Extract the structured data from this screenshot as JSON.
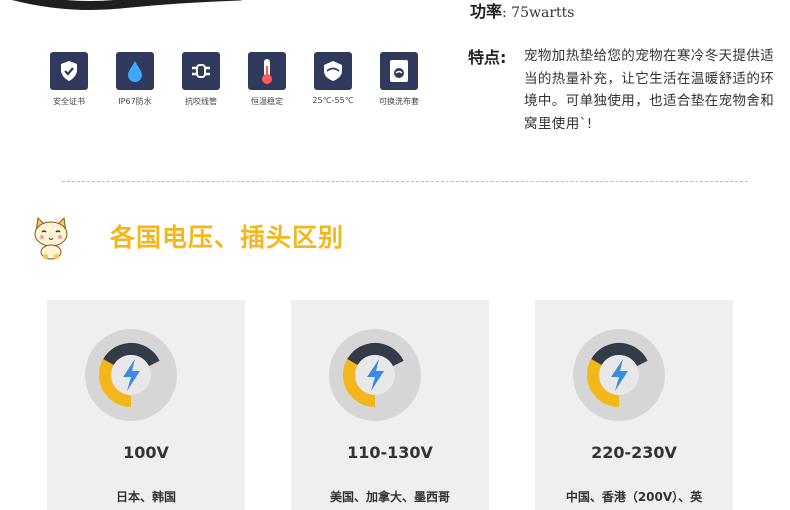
{
  "colors": {
    "accent": "#f3b71b",
    "icon_bg": "#2f3a5c",
    "card_bg": "#efefef"
  },
  "features": [
    {
      "icon": "shield-check-icon",
      "label": "安全证书"
    },
    {
      "icon": "water-drop-icon",
      "label": "IP67防水"
    },
    {
      "icon": "cable-link-icon",
      "label": "抗咬线管"
    },
    {
      "icon": "thermometer-icon",
      "label": "恒温稳定"
    },
    {
      "icon": "temperature-range-icon",
      "label": "25℃-55℃"
    },
    {
      "icon": "washable-cover-icon",
      "label": "可换洗布套"
    }
  ],
  "specs": {
    "power_label": "功率",
    "power_value": ": 75wartts",
    "traits_label": "特点:",
    "traits_text": "宠物加热垫给您的宠物在寒冷冬天提供适当的热量补充，让它生活在温暖舒适的环境中。可单独使用，也适合垫在宠物舍和窝里使用`!"
  },
  "section": {
    "title": "各国电压、插头区别",
    "mascot_icon": "cat-mascot-icon"
  },
  "voltage_cards": [
    {
      "icon": "lightning-gauge-icon",
      "voltage": "100V",
      "region": "日本、韩国"
    },
    {
      "icon": "lightning-gauge-icon",
      "voltage": "110-130V",
      "region": "美国、加拿大、墨西哥"
    },
    {
      "icon": "lightning-gauge-icon",
      "voltage": "220-230V",
      "region": "中国、香港（200V）、英"
    }
  ]
}
